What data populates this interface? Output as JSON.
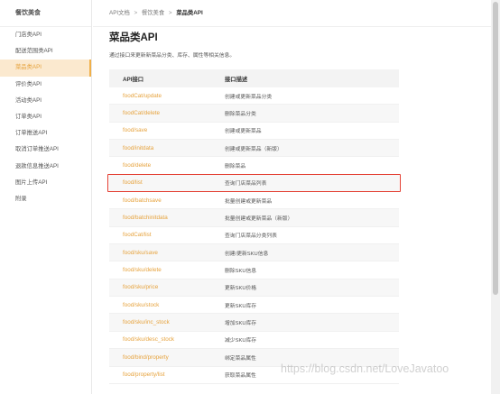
{
  "sidebar": {
    "header": "餐饮美食",
    "items": [
      {
        "label": "门店类API",
        "active": false
      },
      {
        "label": "配送范围类API",
        "active": false
      },
      {
        "label": "菜品类API",
        "active": true
      },
      {
        "label": "评价类API",
        "active": false
      },
      {
        "label": "活动类API",
        "active": false
      },
      {
        "label": "订单类API",
        "active": false
      },
      {
        "label": "订单推送API",
        "active": false
      },
      {
        "label": "取消订单推送API",
        "active": false
      },
      {
        "label": "退款信息推送API",
        "active": false
      },
      {
        "label": "图片上传API",
        "active": false
      },
      {
        "label": "附录",
        "active": false
      }
    ]
  },
  "breadcrumb": {
    "items": [
      "API文档",
      "餐饮美食",
      "菜品类API"
    ],
    "separator": ">"
  },
  "page": {
    "title": "菜品类API",
    "description": "通过接口来更新新菜品分类、库存、属性等相关信息。"
  },
  "table": {
    "headers": [
      "API接口",
      "接口描述"
    ],
    "rows": [
      {
        "api": "foodCat/update",
        "desc": "创建或更新菜品分类"
      },
      {
        "api": "foodCat/delete",
        "desc": "删除菜品分类"
      },
      {
        "api": "food/save",
        "desc": "创建或更新菜品"
      },
      {
        "api": "food/initdata",
        "desc": "创建或更新菜品（新版）"
      },
      {
        "api": "food/delete",
        "desc": "删除菜品"
      },
      {
        "api": "food/list",
        "desc": "查询门店菜品列表",
        "highlighted": true
      },
      {
        "api": "food/batchsave",
        "desc": "批量创建或更新菜品"
      },
      {
        "api": "food/batchinitdata",
        "desc": "批量创建或更新菜品（新版）"
      },
      {
        "api": "foodCat/list",
        "desc": "查询门店菜品分类列表"
      },
      {
        "api": "food/sku/save",
        "desc": "创建/更新SKU信息"
      },
      {
        "api": "food/sku/delete",
        "desc": "删除SKU信息"
      },
      {
        "api": "food/sku/price",
        "desc": "更新SKU价格"
      },
      {
        "api": "food/sku/stock",
        "desc": "更新SKU库存"
      },
      {
        "api": "food/sku/inc_stock",
        "desc": "增加SKU库存"
      },
      {
        "api": "food/sku/desc_stock",
        "desc": "减少SKU库存"
      },
      {
        "api": "food/bind/property",
        "desc": "绑定菜品属性"
      },
      {
        "api": "food/property/list",
        "desc": "获取菜品属性"
      }
    ]
  },
  "watermark": "https://blog.csdn.net/LoveJavatoo",
  "colors": {
    "link": "#e6a23c",
    "active_bg": "#fbe9cf",
    "highlight_border": "#e33b2e"
  }
}
